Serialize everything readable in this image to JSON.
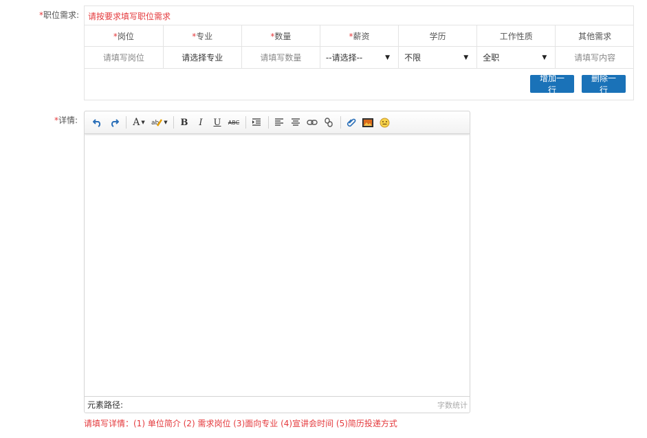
{
  "job_section": {
    "label_star": "*",
    "label": "职位需求:",
    "hint": "请按要求填写职位需求",
    "columns": [
      {
        "star": "*",
        "label": "岗位"
      },
      {
        "star": "*",
        "label": "专业"
      },
      {
        "star": "*",
        "label": "数量"
      },
      {
        "star": "*",
        "label": "薪资"
      },
      {
        "star": "",
        "label": "学历"
      },
      {
        "star": "",
        "label": "工作性质"
      },
      {
        "star": "",
        "label": "其他需求"
      }
    ],
    "row": {
      "position_placeholder": "请填写岗位",
      "major_text": "请选择专业",
      "quantity_placeholder": "请填写数量",
      "salary_selected": "--请选择--",
      "education_selected": "不限",
      "work_type_selected": "全职",
      "other_placeholder": "请填写内容"
    },
    "add_row_label": "增加一行",
    "delete_row_label": "删除一行"
  },
  "detail_section": {
    "label_star": "*",
    "label": "详情:",
    "path_label": "元素路径:",
    "word_count_label": "字数统计",
    "hint": "请填写详情：(1) 单位简介 (2) 需求岗位 (3)面向专业 (4)宣讲会时间 (5)简历投递方式"
  },
  "toolbar_icons": [
    "undo-icon",
    "redo-icon",
    "font-color-icon",
    "highlight-icon",
    "bold-icon",
    "italic-icon",
    "underline-icon",
    "strikethrough-icon",
    "indent-icon",
    "align-left-icon",
    "align-center-icon",
    "link-icon",
    "unlink-icon",
    "attachment-icon",
    "image-icon",
    "emoticon-icon"
  ],
  "colors": {
    "accent": "#1a72b8",
    "required": "#e4393c"
  }
}
